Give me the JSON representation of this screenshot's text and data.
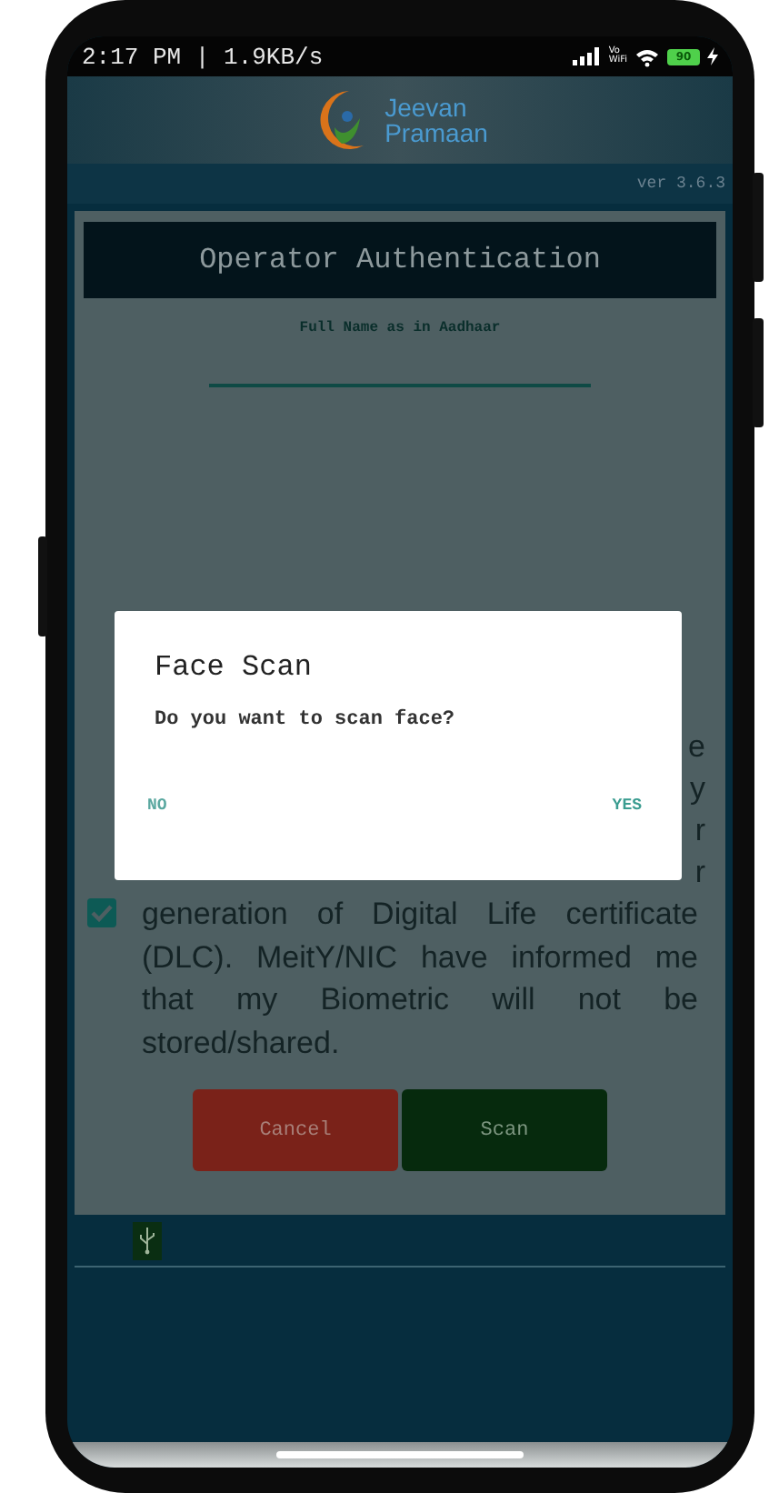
{
  "status_bar": {
    "time": "2:17 PM | 1.9KB/s",
    "vowifi": [
      "Vo",
      "WiFi"
    ],
    "battery": "90"
  },
  "header": {
    "logo_text": [
      "Jeevan",
      "Pramaan"
    ]
  },
  "version": "ver 3.6.3",
  "card": {
    "title": "Operator Authentication",
    "name_label": "Full Name as in Aadhaar",
    "consent": {
      "checked": true,
      "covered_line_ends": [
        "e",
        "y",
        "r",
        "r"
      ],
      "text": "generation of Digital Life certificate (DLC). MeitY/NIC have informed me that my Biometric will not be stored/shared."
    },
    "buttons": [
      {
        "label": "Cancel",
        "kind": "cancel"
      },
      {
        "label": "Scan",
        "kind": "scan"
      }
    ]
  },
  "dialog": {
    "title": "Face Scan",
    "message": "Do you want to scan face?",
    "actions": [
      {
        "label": "NO",
        "kind": "negative"
      },
      {
        "label": "YES",
        "kind": "positive"
      }
    ]
  }
}
